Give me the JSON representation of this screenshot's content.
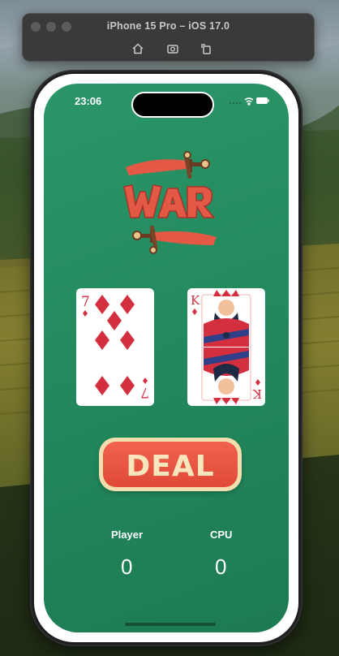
{
  "window": {
    "title": "iPhone 15 Pro – iOS 17.0",
    "toolbar_icons": [
      "home-icon",
      "screenshot-icon",
      "rotate-icon"
    ]
  },
  "status_bar": {
    "time": "23:06",
    "icons": [
      "signal-icon",
      "wifi-icon",
      "battery-icon"
    ]
  },
  "game": {
    "logo_text": "WAR",
    "player_card": {
      "rank": "7",
      "suit": "diamonds"
    },
    "cpu_card": {
      "rank": "K",
      "suit": "diamonds"
    },
    "deal_label": "DEAL",
    "player_label": "Player",
    "cpu_label": "CPU",
    "player_score": "0",
    "cpu_score": "0"
  },
  "colors": {
    "table_green": "#238a5e",
    "accent_red": "#e04a38",
    "cream": "#f3dfae"
  }
}
